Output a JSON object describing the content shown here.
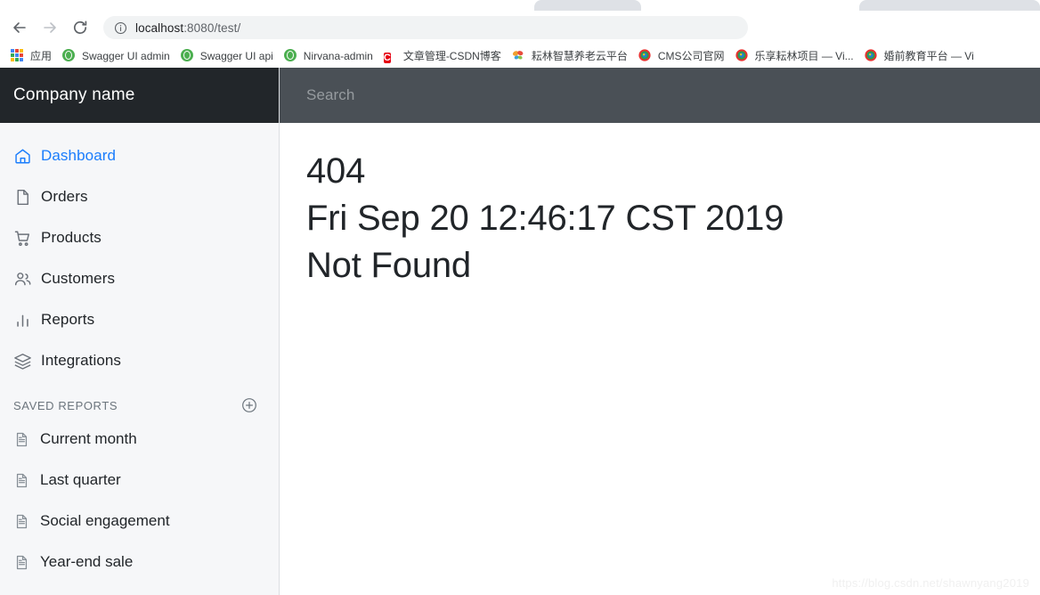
{
  "browser": {
    "nav": {
      "back_icon": "arrow-left-icon",
      "forward_icon": "arrow-right-icon",
      "reload_icon": "reload-icon"
    },
    "omnibox": {
      "info_icon": "info-circle-icon",
      "url_host": "localhost",
      "url_rest": ":8080/test/"
    },
    "bookmarks": [
      {
        "label": "应用",
        "icon": "apps-grid-icon",
        "type": "apps"
      },
      {
        "label": "Swagger UI admin",
        "icon": "swagger-icon",
        "type": "swagger"
      },
      {
        "label": "Swagger UI api",
        "icon": "swagger-icon",
        "type": "swagger"
      },
      {
        "label": "Nirvana-admin",
        "icon": "swagger-icon",
        "type": "swagger"
      },
      {
        "label": "文章管理-CSDN博客",
        "icon": "csdn-icon",
        "type": "csdn"
      },
      {
        "label": "耘林智慧养老云平台",
        "icon": "butterfly-icon",
        "type": "butterfly"
      },
      {
        "label": "CMS公司官网",
        "icon": "globe-icon",
        "type": "globe"
      },
      {
        "label": "乐享耘林项目 — Vi...",
        "icon": "globe-icon",
        "type": "globe"
      },
      {
        "label": "婚前教育平台 — Vi",
        "icon": "globe-icon",
        "type": "globe"
      }
    ]
  },
  "sidebar": {
    "brand": "Company name",
    "nav_items": [
      {
        "label": "Dashboard",
        "icon": "home-icon",
        "active": true
      },
      {
        "label": "Orders",
        "icon": "file-icon",
        "active": false
      },
      {
        "label": "Products",
        "icon": "shopping-cart-icon",
        "active": false
      },
      {
        "label": "Customers",
        "icon": "people-icon",
        "active": false
      },
      {
        "label": "Reports",
        "icon": "bar-chart-icon",
        "active": false
      },
      {
        "label": "Integrations",
        "icon": "layers-icon",
        "active": false
      }
    ],
    "saved_reports": {
      "heading": "SAVED REPORTS",
      "add_icon": "plus-circle-icon",
      "items": [
        {
          "label": "Current month",
          "icon": "document-icon"
        },
        {
          "label": "Last quarter",
          "icon": "document-icon"
        },
        {
          "label": "Social engagement",
          "icon": "document-icon"
        },
        {
          "label": "Year-end sale",
          "icon": "document-icon"
        }
      ]
    }
  },
  "main": {
    "search_placeholder": "Search",
    "error_lines": [
      "404",
      "Fri Sep 20 12:46:17 CST 2019",
      "Not Found"
    ]
  },
  "watermark": "https://blog.csdn.net/shawnyang2019",
  "colors": {
    "accent": "#1a7dfc",
    "sidebar_header_bg": "#22262a",
    "sidebar_bg": "#f6f7f9",
    "topbar_bg": "#4a5056",
    "text": "#212529",
    "muted": "#6c757d"
  }
}
